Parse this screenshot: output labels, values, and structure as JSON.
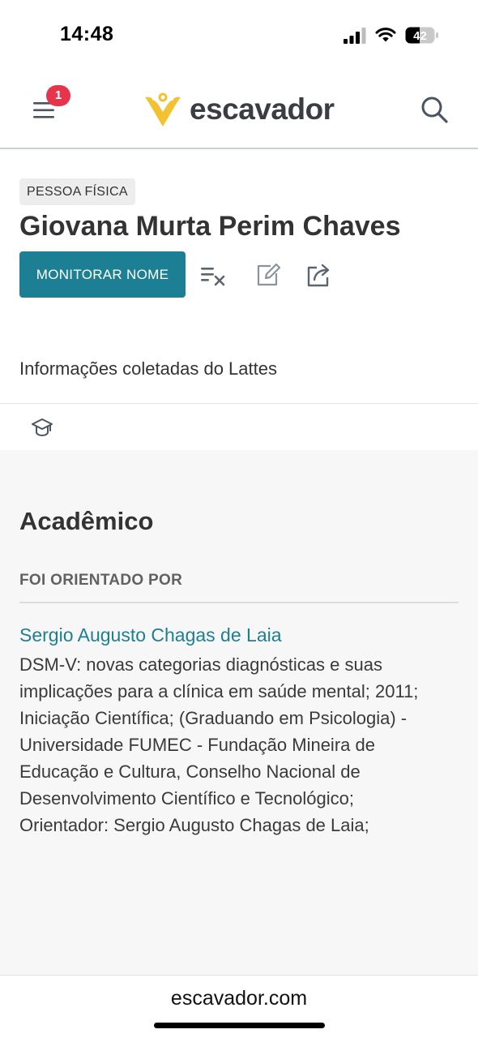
{
  "status_bar": {
    "time": "14:48",
    "battery_level": "42",
    "icons": [
      "signal-icon",
      "wifi-icon",
      "battery-icon"
    ]
  },
  "header": {
    "menu_badge": "1",
    "logo_text": "escavador",
    "icons": [
      "menu-icon",
      "logo-icon",
      "search-icon"
    ],
    "brand_colors": {
      "logo_yellow": "#f2c230",
      "logo_text": "#3a3d42",
      "badge_red": "#e8344b"
    }
  },
  "profile": {
    "type_badge": "PESSOA FÍSICA",
    "name": "Giovana Murta Perim Chaves",
    "monitor_button": "MONITORAR NOME",
    "action_icons": [
      "clear-list-icon",
      "edit-icon",
      "share-icon"
    ],
    "source_info": "Informações coletadas do Lattes",
    "accent_color": "#1d7f94"
  },
  "tabs": {
    "icons": [
      "graduation-cap-icon"
    ]
  },
  "academic": {
    "section_title": "Acadêmico",
    "subsection_title": "FOI ORIENTADO POR",
    "advisor_name": "Sergio Augusto Chagas de Laia",
    "advisor_description": "DSM-V: novas categorias diagnósticas e suas\nimplicações para a clínica em saúde mental; 2011;\nIniciação Científica; (Graduando em Psicologia) -\nUniversidade FUMEC - Fundação Mineira de\nEducação e Cultura, Conselho Nacional de\nDesenvolvimento Científico e Tecnológico;\nOrientador: Sergio Augusto Chagas de Laia;"
  },
  "browser": {
    "domain": "escavador.com"
  }
}
